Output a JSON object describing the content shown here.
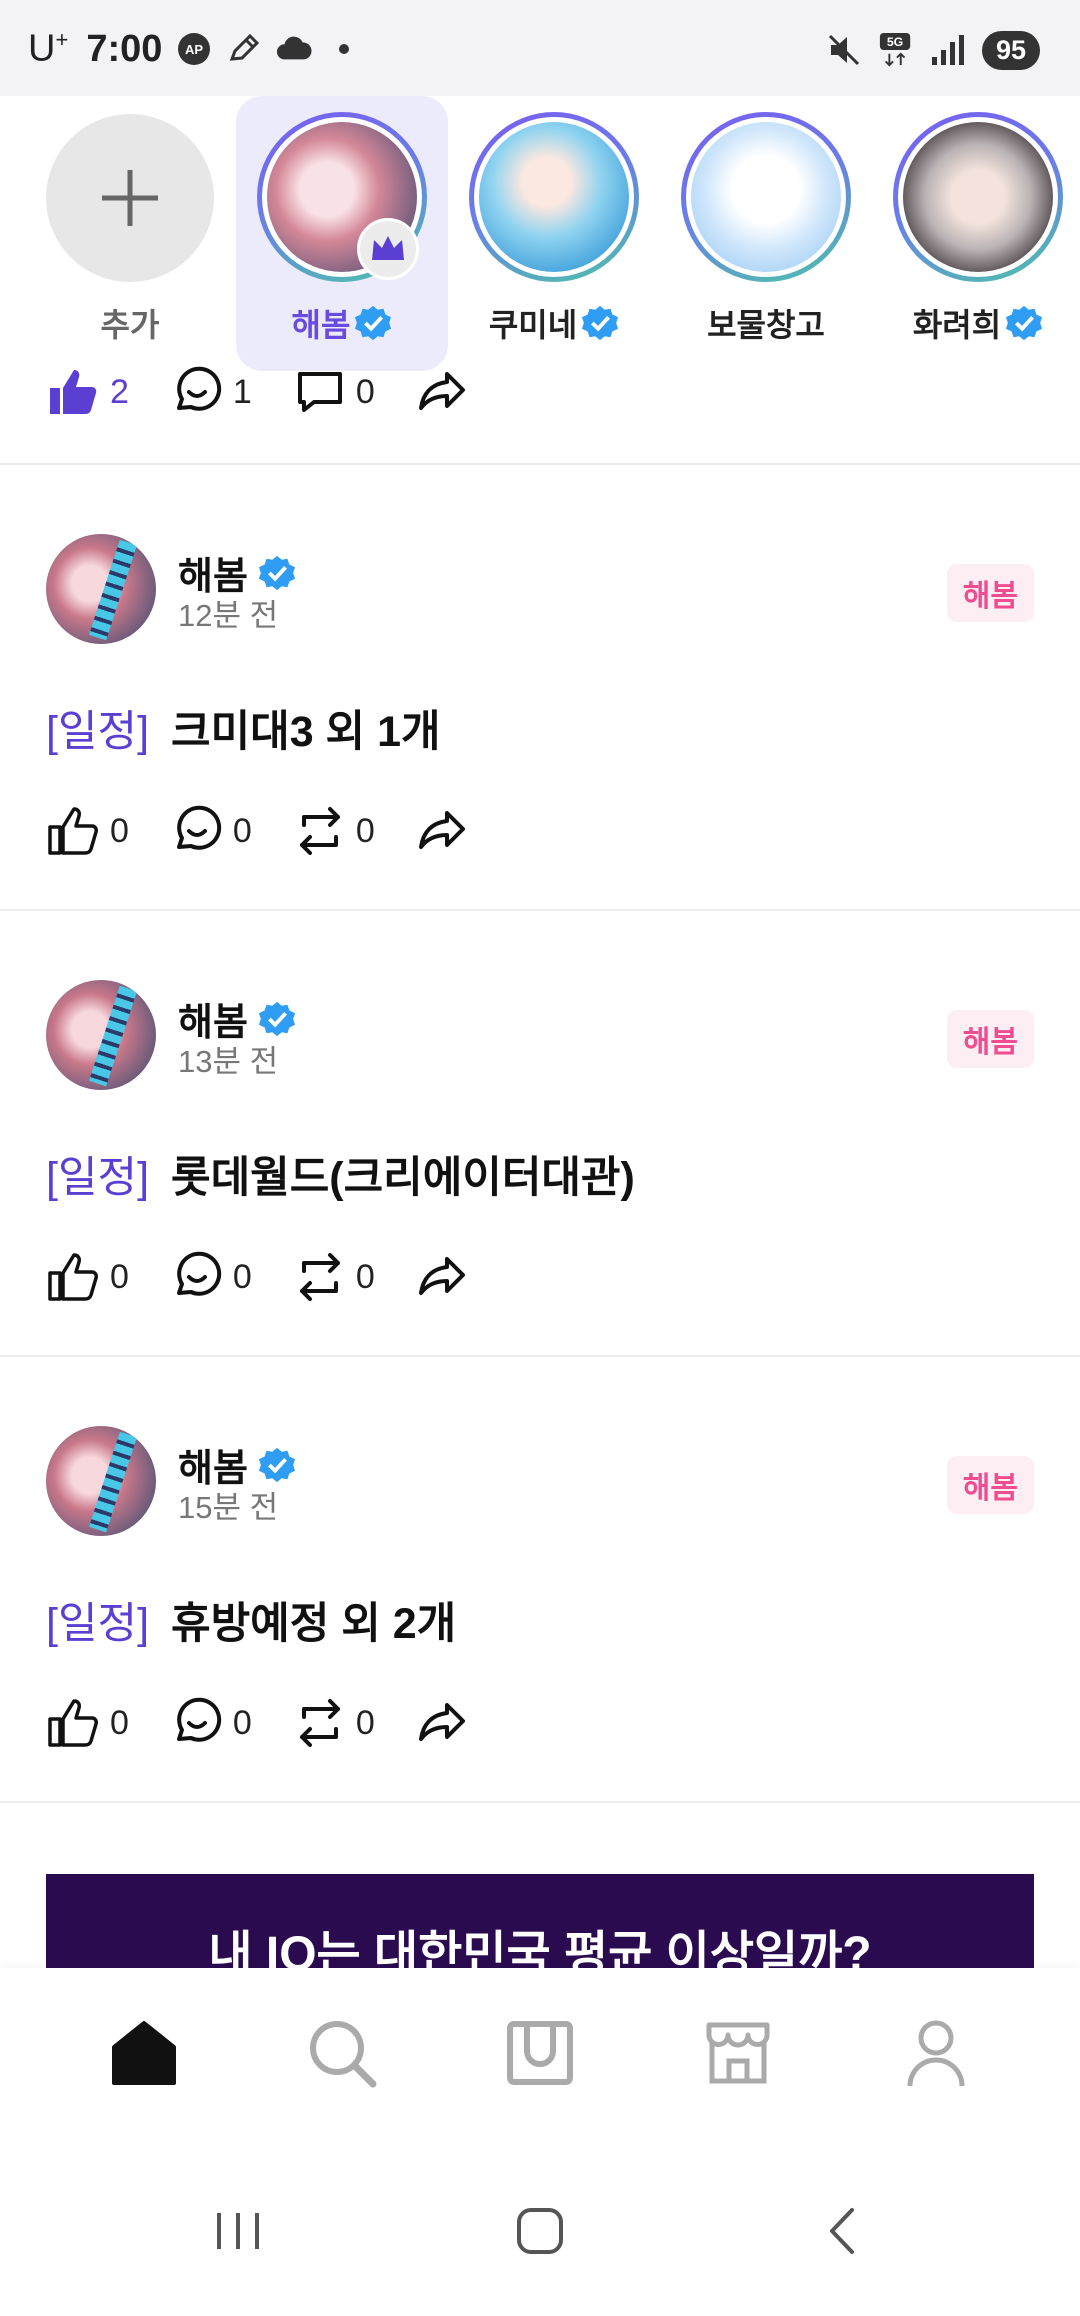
{
  "status_bar": {
    "carrier": "U",
    "carrier_sup": "+",
    "time": "7:00",
    "network": "5G",
    "battery": "95"
  },
  "stories": [
    {
      "name": "추가",
      "type": "add"
    },
    {
      "name": "해봄",
      "verified": true,
      "active": true,
      "crown": true
    },
    {
      "name": "쿠미네",
      "verified": true
    },
    {
      "name": "보물창고",
      "verified": false
    },
    {
      "name": "화려희",
      "verified": true
    }
  ],
  "top_post_actions": {
    "likes": "2",
    "comments": "1",
    "reposts": "0"
  },
  "posts": [
    {
      "author": "해봄",
      "time": "12분 전",
      "tag": "해봄",
      "category": "[일정]",
      "title": "크미대3 외 1개",
      "likes": "0",
      "comments": "0",
      "reposts": "0"
    },
    {
      "author": "해봄",
      "time": "13분 전",
      "tag": "해봄",
      "category": "[일정]",
      "title": "롯데월드(크리에이터대관)",
      "likes": "0",
      "comments": "0",
      "reposts": "0"
    },
    {
      "author": "해봄",
      "time": "15분 전",
      "tag": "해봄",
      "category": "[일정]",
      "title": "휴방예정 외 2개",
      "likes": "0",
      "comments": "0",
      "reposts": "0"
    }
  ],
  "banner": {
    "text": "내 IQ는 대한민국 평균 이상일까?"
  },
  "bottom_nav": [
    "home-icon",
    "search-icon",
    "inbox-icon",
    "store-icon",
    "profile-icon"
  ],
  "colors": {
    "accent": "#5b3fd2",
    "tag_bg": "#fdeef4",
    "tag_text": "#ef4d8f",
    "verified": "#2f9df4",
    "banner": "#2a0b50"
  }
}
